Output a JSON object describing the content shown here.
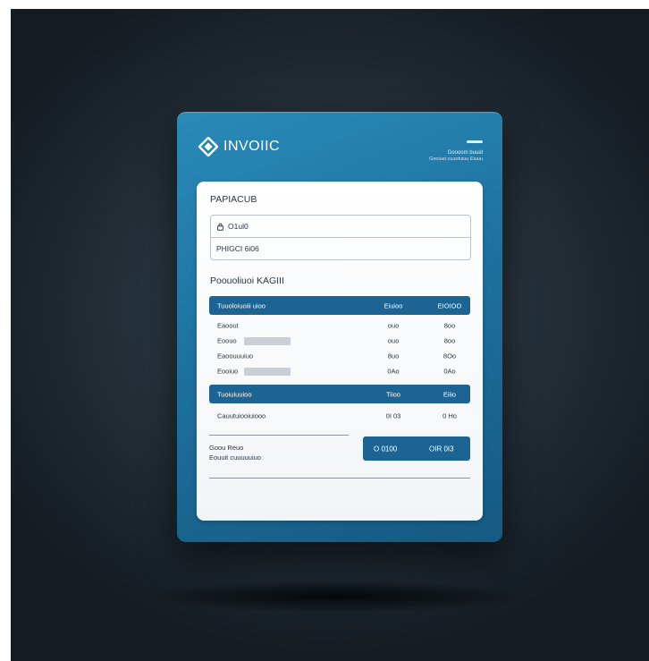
{
  "header": {
    "brand_text": "INVOIIC",
    "meta_line1": "Goooom buuid",
    "meta_line2": "Gooiuei cuuotuiuu Eiuuu"
  },
  "paper": {
    "title": "PAPIACUB",
    "fields": [
      {
        "icon": "lock-icon",
        "label": "O1ul0"
      },
      {
        "label": "PHIGCI 6i06"
      }
    ],
    "section_title": "Poouoliuoi KAGIII",
    "table1": {
      "header": [
        "Tuuoloiuoiii uioo",
        "Eiuioo",
        "EIOIOO"
      ],
      "rows": [
        {
          "label": "Eaoout",
          "has_placeholder": false,
          "c2": "ouo",
          "c3": "8oo"
        },
        {
          "label": "Eoouo",
          "has_placeholder": true,
          "c2": "ouo",
          "c3": "8oo"
        },
        {
          "label": "Eaoouuuiuo",
          "has_placeholder": false,
          "c2": "8uo",
          "c3": "8Oo"
        },
        {
          "label": "Eooiuo",
          "has_placeholder": true,
          "c2": "0Ao",
          "c3": "0Ao"
        }
      ]
    },
    "table2": {
      "header": [
        "Tuoiuiuuioo",
        "Tiioo",
        "Eiiio"
      ],
      "row": {
        "label": "Cauutuiooiuiooo",
        "c2": "0I 03",
        "c3": "0 Ho"
      }
    },
    "totals": {
      "label1": "Goou Reuo",
      "label2": "Eouuit cuuuuuiuo",
      "value1": "O 0100",
      "value2": "OIR 0I3"
    }
  },
  "colors": {
    "card_blue": "#1e72a0",
    "header_blue": "#1b6494",
    "background": "#26323c"
  }
}
